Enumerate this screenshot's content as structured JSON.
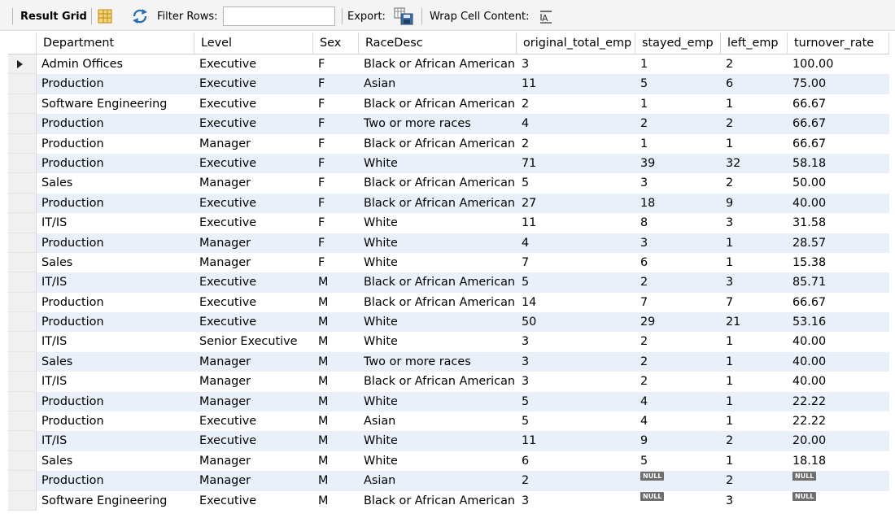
{
  "toolbar": {
    "result_grid_label": "Result Grid",
    "filter_rows_label": "Filter Rows:",
    "filter_rows_value": "",
    "export_label": "Export:",
    "wrap_label": "Wrap Cell Content:"
  },
  "grid": {
    "columns": [
      "Department",
      "Level",
      "Sex",
      "RaceDesc",
      "original_total_emp",
      "stayed_emp",
      "left_emp",
      "turnover_rate"
    ],
    "rows": [
      [
        "Admin Offices",
        "Executive",
        "F",
        "Black or African American",
        "3",
        "1",
        "2",
        "100.00"
      ],
      [
        "Production",
        "Executive",
        "F",
        "Asian",
        "11",
        "5",
        "6",
        "75.00"
      ],
      [
        "Software Engineering",
        "Executive",
        "F",
        "Black or African American",
        "2",
        "1",
        "1",
        "66.67"
      ],
      [
        "Production",
        "Executive",
        "F",
        "Two or more races",
        "4",
        "2",
        "2",
        "66.67"
      ],
      [
        "Production",
        "Manager",
        "F",
        "Black or African American",
        "2",
        "1",
        "1",
        "66.67"
      ],
      [
        "Production",
        "Executive",
        "F",
        "White",
        "71",
        "39",
        "32",
        "58.18"
      ],
      [
        "Sales",
        "Manager",
        "F",
        "Black or African American",
        "5",
        "3",
        "2",
        "50.00"
      ],
      [
        "Production",
        "Executive",
        "F",
        "Black or African American",
        "27",
        "18",
        "9",
        "40.00"
      ],
      [
        "IT/IS",
        "Executive",
        "F",
        "White",
        "11",
        "8",
        "3",
        "31.58"
      ],
      [
        "Production",
        "Manager",
        "F",
        "White",
        "4",
        "3",
        "1",
        "28.57"
      ],
      [
        "Sales",
        "Manager",
        "F",
        "White",
        "7",
        "6",
        "1",
        "15.38"
      ],
      [
        "IT/IS",
        "Executive",
        "M",
        "Black or African American",
        "5",
        "2",
        "3",
        "85.71"
      ],
      [
        "Production",
        "Executive",
        "M",
        "Black or African American",
        "14",
        "7",
        "7",
        "66.67"
      ],
      [
        "Production",
        "Executive",
        "M",
        "White",
        "50",
        "29",
        "21",
        "53.16"
      ],
      [
        "IT/IS",
        "Senior Executive",
        "M",
        "White",
        "3",
        "2",
        "1",
        "40.00"
      ],
      [
        "Sales",
        "Manager",
        "M",
        "Two or more races",
        "3",
        "2",
        "1",
        "40.00"
      ],
      [
        "IT/IS",
        "Manager",
        "M",
        "Black or African American",
        "3",
        "2",
        "1",
        "40.00"
      ],
      [
        "Production",
        "Manager",
        "M",
        "White",
        "5",
        "4",
        "1",
        "22.22"
      ],
      [
        "Production",
        "Executive",
        "M",
        "Asian",
        "5",
        "4",
        "1",
        "22.22"
      ],
      [
        "IT/IS",
        "Executive",
        "M",
        "White",
        "11",
        "9",
        "2",
        "20.00"
      ],
      [
        "Sales",
        "Manager",
        "M",
        "White",
        "6",
        "5",
        "1",
        "18.18"
      ],
      [
        "Production",
        "Manager",
        "M",
        "Asian",
        "2",
        "NULL",
        "2",
        "NULL"
      ],
      [
        "Software Engineering",
        "Executive",
        "M",
        "Black or African American",
        "3",
        "NULL",
        "3",
        "NULL"
      ]
    ]
  },
  "colors": {
    "alt_row": "#eaf0fa",
    "null_badge": "#6e6e6e",
    "grid_icon": "#d9a21b",
    "refresh_icon": "#2e6fb4",
    "export_icon": "#3a6ea5"
  },
  "icons": {
    "grid": "table-grid-icon",
    "refresh": "refresh-arrows-icon",
    "export": "save-disk-icon",
    "wrap": "wrap-text-icon"
  }
}
